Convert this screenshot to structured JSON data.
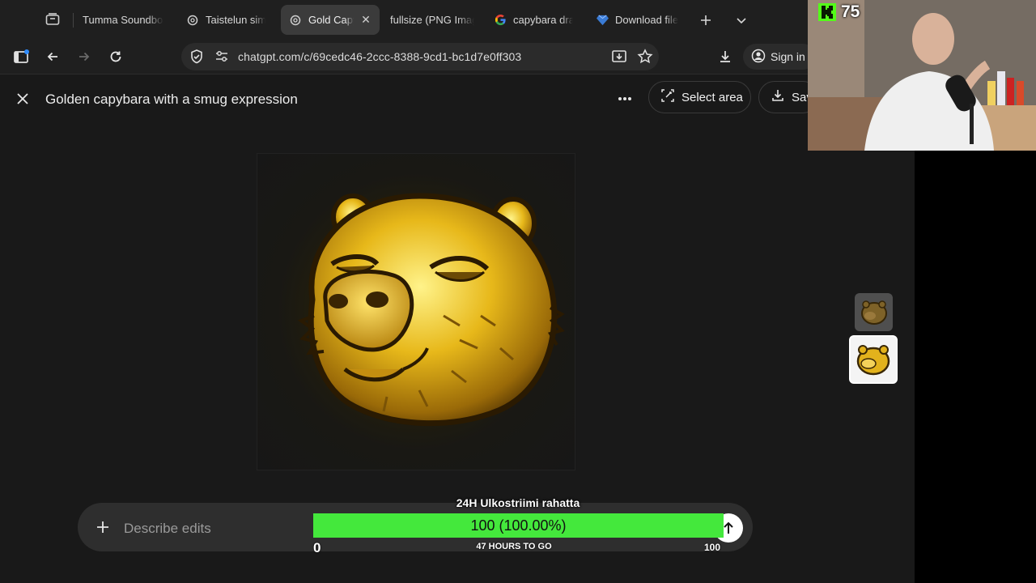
{
  "browser": {
    "tabs": [
      {
        "label": "Tumma Soundboard",
        "icon": "soundboard-favicon",
        "active": false
      },
      {
        "label": "Taistelun simulaattori",
        "icon": "openai-favicon",
        "active": false
      },
      {
        "label": "Gold Capybara",
        "icon": "openai-favicon",
        "active": true
      },
      {
        "label": "fullsize (PNG Image)",
        "icon": "",
        "active": false
      },
      {
        "label": "capybara drawing",
        "icon": "google-favicon",
        "active": false
      },
      {
        "label": "Download file",
        "icon": "gem-favicon",
        "active": false
      }
    ],
    "url": "chatgpt.com/c/69cedc46-2ccc-8388-9cd1-bc1d7e0ff303",
    "sign_in_label": "Sign in"
  },
  "viewer": {
    "title": "Golden capybara with a smug expression",
    "select_area_label": "Select area",
    "save_label": "Save",
    "composer_placeholder": "Describe edits"
  },
  "donation_goal": {
    "title": "24H Ulkostriimi rahatta",
    "value_text": "100 (100.00%)",
    "progress": 1.0,
    "min": "0",
    "max": "100",
    "subtitle": "47 HOURS TO GO",
    "bar_color": "#44e83c"
  },
  "stream": {
    "kick_viewers": "75",
    "kick_color": "#53fc18"
  }
}
